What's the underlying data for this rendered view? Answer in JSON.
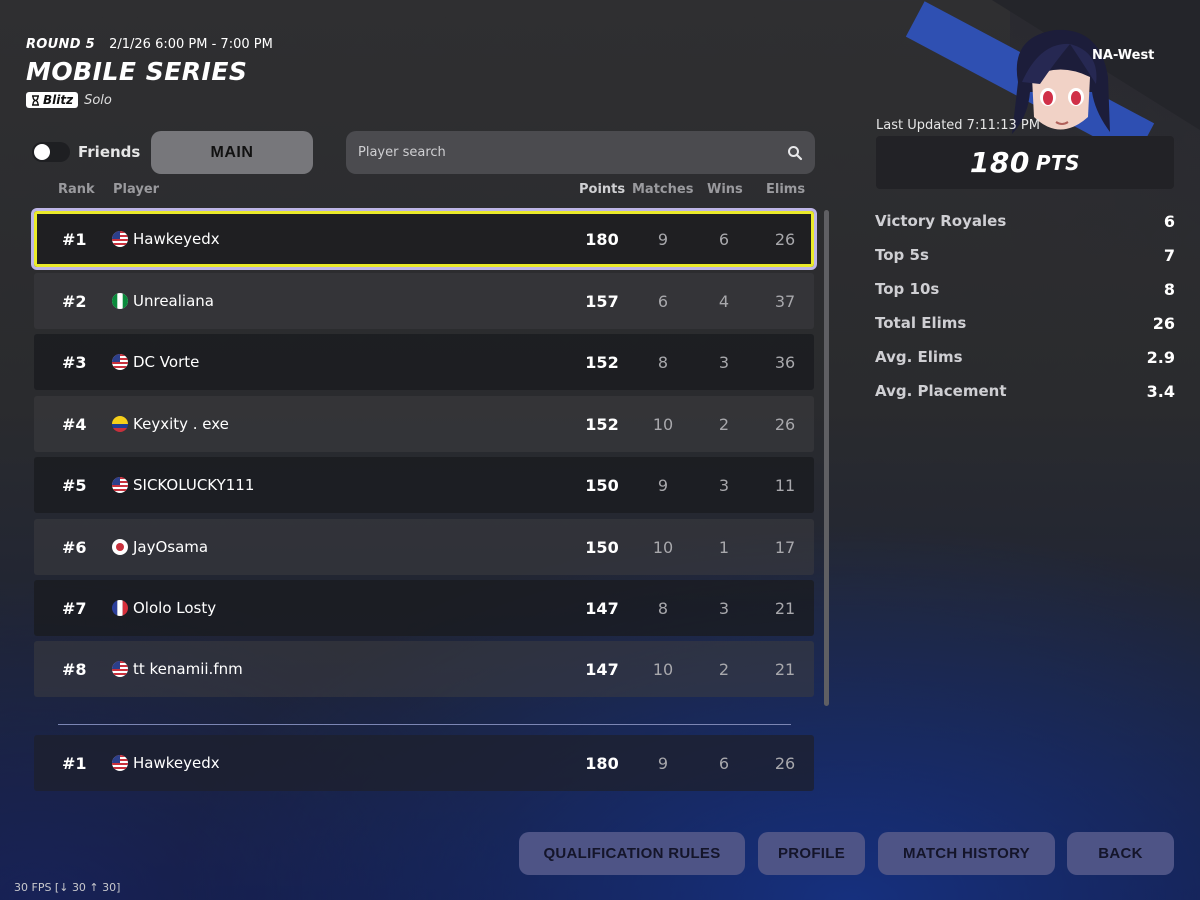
{
  "header": {
    "round": "ROUND 5",
    "time_range": "2/1/26 6:00 PM - 7:00 PM",
    "title": "MOBILE SERIES",
    "mode_badge": "Blitz",
    "mode_sub": "Solo"
  },
  "controls": {
    "friends_label": "Friends",
    "friends_toggle_on": false,
    "main_tab": "MAIN",
    "search_placeholder": "Player search"
  },
  "table": {
    "columns": {
      "rank": "Rank",
      "player": "Player",
      "points": "Points",
      "matches": "Matches",
      "wins": "Wins",
      "elims": "Elims"
    },
    "rows": [
      {
        "rank": "#1",
        "flag": "us",
        "player": "Hawkeyedx",
        "points": "180",
        "matches": "9",
        "wins": "6",
        "elims": "26",
        "selected": true
      },
      {
        "rank": "#2",
        "flag": "ng",
        "player": "Unrealiana",
        "points": "157",
        "matches": "6",
        "wins": "4",
        "elims": "37"
      },
      {
        "rank": "#3",
        "flag": "us",
        "player": "DC Vorte",
        "points": "152",
        "matches": "8",
        "wins": "3",
        "elims": "36"
      },
      {
        "rank": "#4",
        "flag": "co",
        "player": "Keyxity . exe",
        "points": "152",
        "matches": "10",
        "wins": "2",
        "elims": "26"
      },
      {
        "rank": "#5",
        "flag": "us",
        "player": "SICKOLUCKY111",
        "points": "150",
        "matches": "9",
        "wins": "3",
        "elims": "11"
      },
      {
        "rank": "#6",
        "flag": "jp",
        "player": "JayOsama",
        "points": "150",
        "matches": "10",
        "wins": "1",
        "elims": "17"
      },
      {
        "rank": "#7",
        "flag": "fr",
        "player": "Ololo Losty",
        "points": "147",
        "matches": "8",
        "wins": "3",
        "elims": "21"
      },
      {
        "rank": "#8",
        "flag": "us",
        "player": "tt kenamii.fnm",
        "points": "147",
        "matches": "10",
        "wins": "2",
        "elims": "21"
      }
    ],
    "my_row": {
      "rank": "#1",
      "flag": "us",
      "player": "Hawkeyedx",
      "points": "180",
      "matches": "9",
      "wins": "6",
      "elims": "26"
    }
  },
  "profile": {
    "region": "NA-West",
    "last_updated": "Last Updated 7:11:13 PM",
    "points_value": "180",
    "points_unit": "PTS",
    "stats": [
      {
        "label": "Victory Royales",
        "value": "6"
      },
      {
        "label": "Top 5s",
        "value": "7"
      },
      {
        "label": "Top 10s",
        "value": "8"
      },
      {
        "label": "Total Elims",
        "value": "26"
      },
      {
        "label": "Avg. Elims",
        "value": "2.9"
      },
      {
        "label": "Avg. Placement",
        "value": "3.4"
      }
    ]
  },
  "buttons": {
    "qualification_rules": "QUALIFICATION RULES",
    "profile": "PROFILE",
    "match_history": "MATCH HISTORY",
    "back": "BACK"
  },
  "fps_overlay": "30 FPS [↓ 30 ↑ 30]",
  "colors": {
    "selected_outline": "#eaea2a",
    "button_bg": "#4e5486",
    "main_tab_bg": "#77777b"
  }
}
